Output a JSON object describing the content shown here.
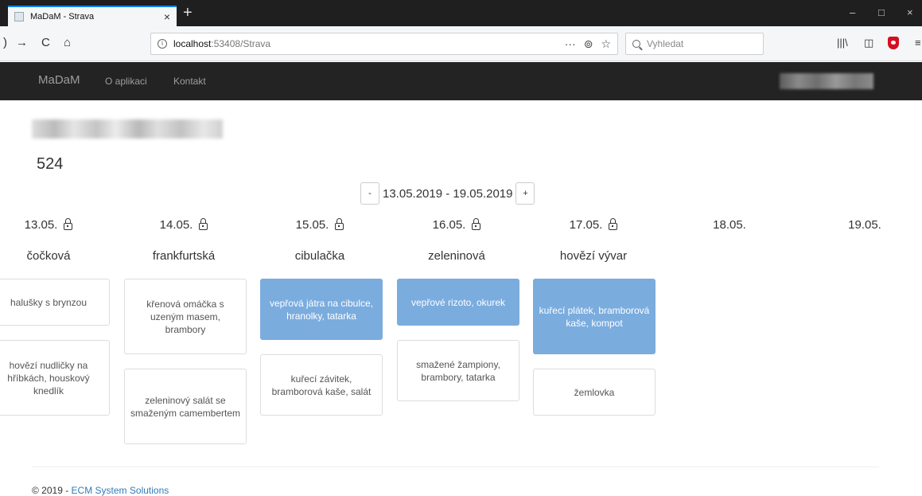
{
  "browser": {
    "tab_title": "MaDaM - Strava",
    "url_host": "localhost",
    "url_path": ":53408/Strava",
    "search_placeholder": "Vyhledat"
  },
  "site": {
    "brand": "MaDaM",
    "nav": [
      "O aplikaci",
      "Kontakt"
    ]
  },
  "main": {
    "number": "524",
    "week": {
      "range": "13.05.2019 - 19.05.2019",
      "prev_label": "-",
      "next_label": "+"
    },
    "days": [
      {
        "date": "13.05.",
        "locked": true,
        "soup": "čočková",
        "meals": [
          {
            "text": "halušky s brynzou",
            "selected": false
          },
          {
            "text": "hovězí nudličky na hříbkách, houskový knedlík",
            "selected": false
          }
        ]
      },
      {
        "date": "14.05.",
        "locked": true,
        "soup": "frankfurtská",
        "meals": [
          {
            "text": "křenová omáčka s uzeným masem, brambory",
            "selected": false
          },
          {
            "text": "zeleninový salát se smaženým camembertem",
            "selected": false
          }
        ]
      },
      {
        "date": "15.05.",
        "locked": true,
        "soup": "cibulačka",
        "meals": [
          {
            "text": "vepřová játra na cibulce, hranolky, tatarka",
            "selected": true
          },
          {
            "text": "kuřecí závitek, bramborová kaše, salát",
            "selected": false
          }
        ]
      },
      {
        "date": "16.05.",
        "locked": true,
        "soup": "zeleninová",
        "meals": [
          {
            "text": "vepřové rizoto, okurek",
            "selected": true
          },
          {
            "text": "smažené žampiony, brambory, tatarka",
            "selected": false
          }
        ]
      },
      {
        "date": "17.05.",
        "locked": true,
        "soup": "hovězí vývar",
        "meals": [
          {
            "text": "kuřecí plátek, bramborová kaše, kompot",
            "selected": true
          },
          {
            "text": "žemlovka",
            "selected": false
          }
        ]
      },
      {
        "date": "18.05.",
        "locked": false,
        "soup": "",
        "meals": []
      },
      {
        "date": "19.05.",
        "locked": false,
        "soup": "",
        "meals": []
      }
    ]
  },
  "footer": {
    "prefix": "© 2019 - ",
    "link": "ECM System Solutions"
  },
  "colors": {
    "selected_meal": "#7bacde",
    "navbar_bg": "#232323",
    "link": "#337ab7"
  }
}
